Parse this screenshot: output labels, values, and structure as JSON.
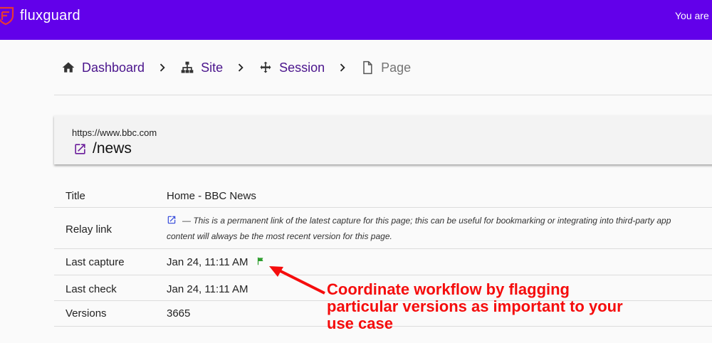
{
  "header": {
    "app_name": "fluxguard",
    "user_text": "You are",
    "brand_color": "#6200ea",
    "logo_color": "#e53935"
  },
  "breadcrumb": {
    "items": [
      {
        "label": "Dashboard",
        "icon": "home-icon"
      },
      {
        "label": "Site",
        "icon": "sitemap-icon"
      },
      {
        "label": "Session",
        "icon": "move-arrows-icon"
      },
      {
        "label": "Page",
        "icon": "file-icon"
      }
    ],
    "separator_icon": "chevron-right-icon",
    "link_color": "#4a148c"
  },
  "url_card": {
    "host": "https://www.bbc.com",
    "path": "/news",
    "icon": "open-external-icon"
  },
  "details": {
    "title_label": "Title",
    "title_value": "Home - BBC News",
    "relay_label": "Relay link",
    "relay_line1": "— This is a permanent link of the latest capture for this page; this can be useful for bookmarking or integrating into third-party app",
    "relay_line2": "content will always be the most recent version for this page.",
    "last_capture_label": "Last capture",
    "last_capture_value": "Jan 24, 11:11 AM",
    "flag_color": "#2e9e2e",
    "last_check_label": "Last check",
    "last_check_value": "Jan 24, 11:11 AM",
    "versions_label": "Versions",
    "versions_value": "3665"
  },
  "callout": {
    "line1": "Coordinate workflow by flagging",
    "line2": "particular versions as important to your",
    "line3": "use case",
    "color": "#f50d0d"
  }
}
